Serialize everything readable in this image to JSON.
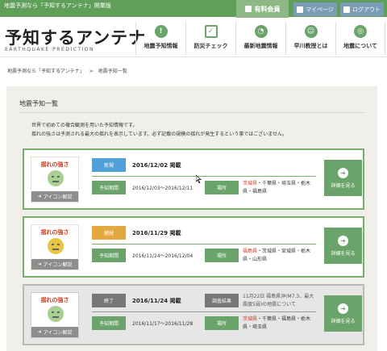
{
  "topbar": {
    "tagline": "地震予測なら「予知するアンテナ」開業版",
    "member_label": "有料会員",
    "mypage_label": "マイページ",
    "logout_label": "ログアウト"
  },
  "logo": {
    "title": "予知するアンテナ",
    "subtitle": "EARTHQUAKE PREDICTION"
  },
  "nav": [
    {
      "label": "地震予知情報",
      "icon": "alert-icon"
    },
    {
      "label": "防災チェック",
      "icon": "checklist-icon"
    },
    {
      "label": "最新地震情報",
      "icon": "rss-icon"
    },
    {
      "label": "早川教授とは",
      "icon": "professor-icon"
    },
    {
      "label": "地震について",
      "icon": "target-icon"
    }
  ],
  "breadcrumb": {
    "home": "地震予測なら「予知するアンテナ」",
    "separator": ">",
    "current": "地震予知一覧"
  },
  "panel": {
    "title": "地震予知一覧",
    "intro1": "世界で初めての複合観測を用いた予知情報です。",
    "intro2": "揺れの強さは予測される最大の揺れを表示しています。必ず記載の規模の揺れが発生するという事ではございません。"
  },
  "common": {
    "yure_title": "揺れの強さ",
    "icon_link": "アイコン解説",
    "period_label": "予知期間",
    "place_label": "場所",
    "detail_label": "詳細を見る"
  },
  "cards": [
    {
      "status": "新規",
      "date": "2016/12/02 掲載",
      "period": "2016/12/03〜2016/12/11",
      "place_red": "茨城県",
      "place_rest": "・千葉県・埼玉県・栃木県・福島県"
    },
    {
      "status": "継続",
      "date": "2016/11/29 掲載",
      "period": "2016/11/24〜2016/12/04",
      "place_red": "福島県",
      "place_rest": "・茨城県・宮城県・栃木県・山形県"
    },
    {
      "status": "終了",
      "date": "2016/11/24 掲載",
      "report_label": "調査結果",
      "report_text": "11月22日 福島県沖(M7.3、最大震度5弱)の地震について",
      "period": "2016/11/17〜2016/11/28",
      "place_red": "茨城県",
      "place_rest": "・千葉県・福島県・栃木県・埼玉県"
    }
  ],
  "colors": {
    "brand_green": "#5f9f5a",
    "status_new": "#4fa0d8",
    "status_continue": "#e3a83f",
    "status_end": "#777777",
    "highlight_red": "#d03a1f"
  }
}
